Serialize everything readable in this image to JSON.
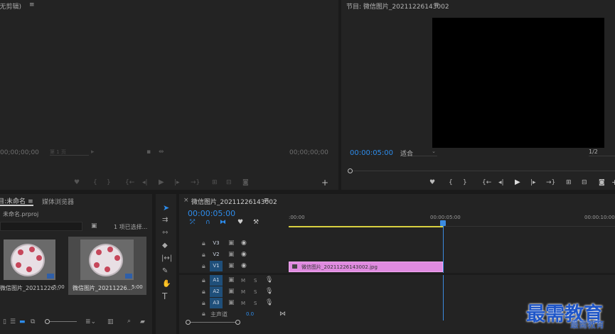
{
  "source_monitor": {
    "title": "(无剪辑)",
    "timecode_left": "00;00;00;00",
    "timecode_right": "00;00;00;00",
    "page_select": "第 1 页"
  },
  "program_monitor": {
    "title": "节目: 微信图片_20211226143002",
    "timecode": "00:00:05:00",
    "fit": "适合",
    "resolution": "1/2"
  },
  "project_panel": {
    "tab_project": "未命名",
    "tab_media": "媒体浏览器",
    "project_file": "未命名.prproj",
    "selection_info": "1 项已选择...",
    "items": [
      {
        "name": "微信图片_20211226...",
        "duration": "5:00"
      },
      {
        "name": "微信图片_20211226...",
        "duration": "5:00"
      }
    ]
  },
  "timeline": {
    "sequence_tab": "微信图片_20211226143002",
    "timecode": "00:00:05:00",
    "ruler": [
      ":00:00",
      "00:00:05:00",
      "00:00:10:00"
    ],
    "video_tracks": [
      "V3",
      "V2",
      "V1"
    ],
    "audio_tracks": [
      "A1",
      "A2",
      "A3"
    ],
    "master_label": "主声道",
    "master_value": "0.0",
    "clip_label": "微信图片_20211226143002.jpg",
    "track_m": "M",
    "track_s": "S"
  },
  "watermark": {
    "main": "最需教育",
    "sub": "最需教育"
  },
  "colors": {
    "accent": "#2d8ceb",
    "clip": "#e08be0",
    "playhead": "#3b8be0",
    "work_area": "#d8d040"
  }
}
